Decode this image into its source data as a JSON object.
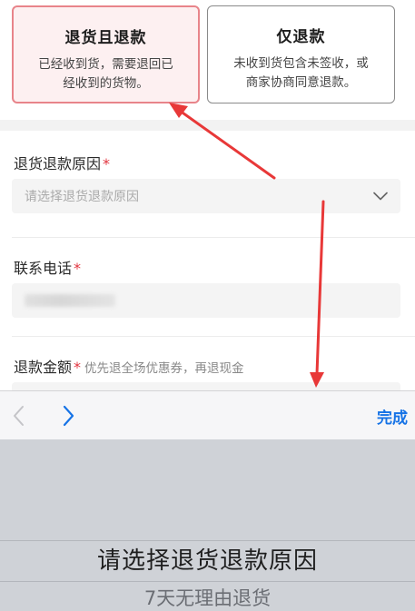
{
  "options": [
    {
      "title": "退货且退款",
      "description_line1": "已经收到货，需要退回已",
      "description_line2": "经收到的货物。",
      "selected": true
    },
    {
      "title": "仅退款",
      "description_line1": "未收到货包含未签收，或",
      "description_line2": "商家协商同意退款。",
      "selected": false
    }
  ],
  "form": {
    "reason": {
      "label": "退货退款原因",
      "required_mark": "*",
      "placeholder": "请选择退货退款原因"
    },
    "phone": {
      "label": "联系电话",
      "required_mark": "*"
    },
    "amount": {
      "label": "退款金额",
      "required_mark": "*",
      "hint": "优先退全场优惠券，再退现金"
    }
  },
  "toolbar": {
    "done_label": "完成"
  },
  "picker": {
    "selected_option": "请选择退货退款原因",
    "next_option": "7天无理由退货"
  },
  "colors": {
    "accent": "#1673e6",
    "selected_border": "#e8848a",
    "selected_bg": "#fdf0f1",
    "required": "#e2333e",
    "arrow": "#e83838"
  }
}
